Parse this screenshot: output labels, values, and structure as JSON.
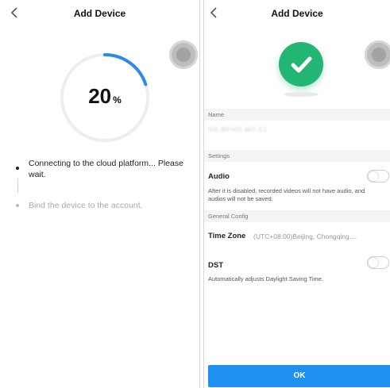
{
  "left_panel": {
    "title": "Add Device",
    "progress": {
      "value": 20,
      "number": "20",
      "unit": "%"
    },
    "steps": [
      {
        "text": "Connecting to the cloud platform... Please wait.",
        "state": "active"
      },
      {
        "text": "Bind the device to the account.",
        "state": "pending"
      }
    ]
  },
  "right_panel": {
    "title": "Add Device",
    "name_section": {
      "header": "Name",
      "value": "SN-BFHO-M2-S1"
    },
    "settings_section": {
      "header": "Settings",
      "audio": {
        "label": "Audio",
        "description": "After it is disabled, recorded videos will not have audio, and audios will not be saved.",
        "enabled": false
      }
    },
    "general_config": {
      "header": "General Config",
      "time_zone": {
        "label": "Time Zone",
        "value": "(UTC+08:00)Beijing, Chongqing,..."
      },
      "dst": {
        "label": "DST",
        "description": "Automatically adjusts Daylight Saving Time.",
        "enabled": false
      }
    },
    "ok_label": "OK"
  },
  "colors": {
    "accent": "#1e90f0",
    "success": "#22b573",
    "progress_track": "#eeeeee",
    "progress_fill": "#2b8be8"
  },
  "icons": {
    "back": "chevron-left-icon",
    "success": "check-icon",
    "floating": "assistive-touch-icon"
  }
}
